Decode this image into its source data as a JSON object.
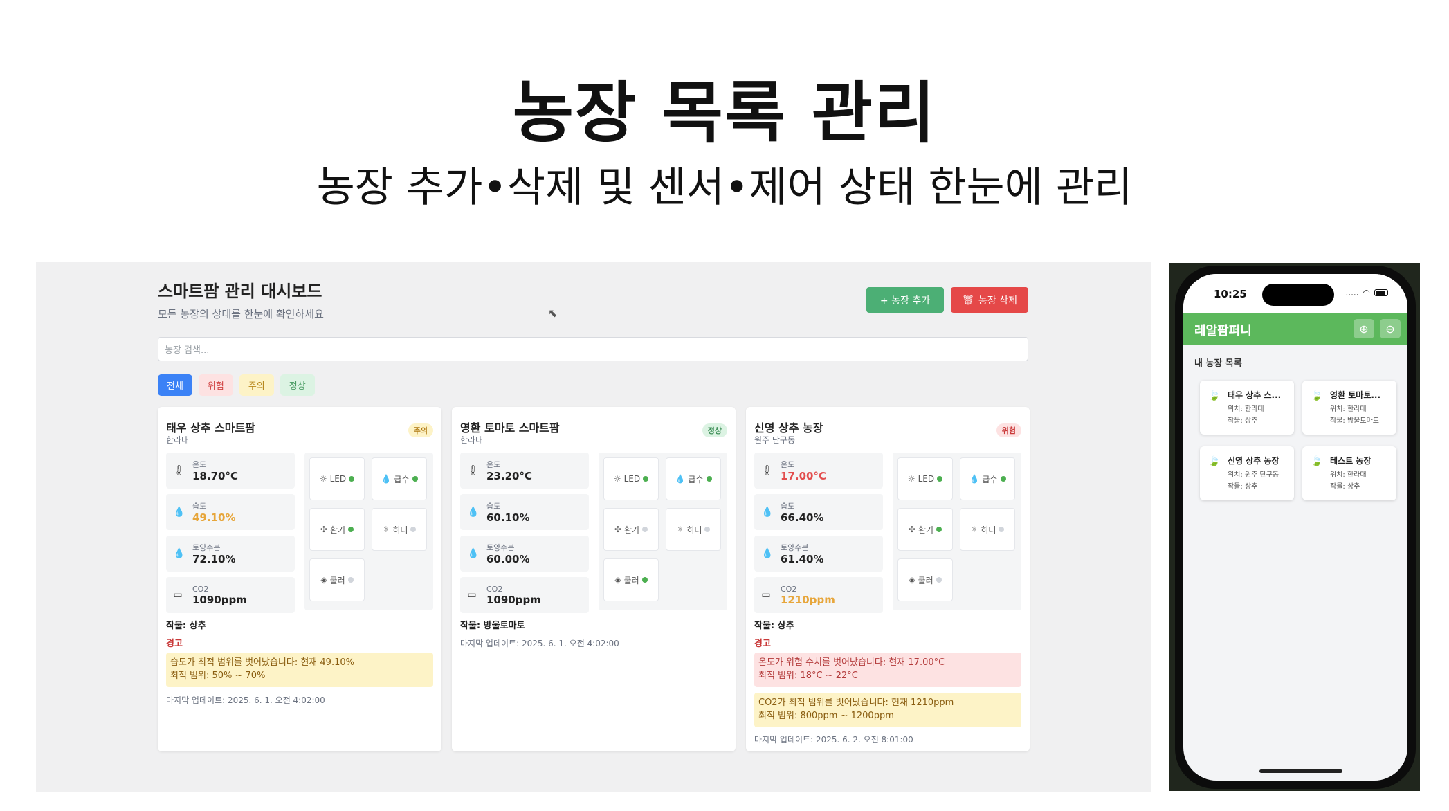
{
  "hero": {
    "title": "농장 목록 관리",
    "subtitle": "농장 추가•삭제 및 센서•제어 상태 한눈에 관리"
  },
  "dashboard": {
    "title": "스마트팜 관리 대시보드",
    "subtitle": "모든 농장의 상태를 한눈에 확인하세요",
    "add_button": "+ 농장 추가",
    "delete_button": "농장 삭제",
    "search_placeholder": "농장 검색...",
    "filters": [
      "전체",
      "위험",
      "주의",
      "정상"
    ],
    "sensor_labels": [
      "온도",
      "습도",
      "토양수분",
      "CO2"
    ],
    "control_labels": [
      "LED",
      "급수",
      "환기",
      "히터",
      "쿨러"
    ],
    "warning_header": "경고",
    "farms": [
      {
        "name": "태우 상추 스마트팜",
        "location": "한라대",
        "status": "주의",
        "temp": "18.70°C",
        "humidity": "49.10%",
        "soil": "72.10%",
        "co2": "1090ppm",
        "controls": {
          "led": true,
          "water": true,
          "vent": true,
          "heater": false,
          "cooler": false
        },
        "crop": "작물: 상추",
        "alerts": [
          {
            "line1": "습도가 최적 범위를 벗어났습니다: 현재 49.10%",
            "line2": "최적 범위: 50% ~ 70%"
          }
        ],
        "updated": "마지막 업데이트: 2025. 6. 1. 오전 4:02:00"
      },
      {
        "name": "영환 토마토 스마트팜",
        "location": "한라대",
        "status": "정상",
        "temp": "23.20°C",
        "humidity": "60.10%",
        "soil": "60.00%",
        "co2": "1090ppm",
        "controls": {
          "led": true,
          "water": true,
          "vent": false,
          "heater": false,
          "cooler": true
        },
        "crop": "작물: 방울토마토",
        "alerts": [],
        "updated": "마지막 업데이트: 2025. 6. 1. 오전 4:02:00"
      },
      {
        "name": "신영 상추 농장",
        "location": "원주 단구동",
        "status": "위험",
        "temp": "17.00°C",
        "humidity": "66.40%",
        "soil": "61.40%",
        "co2": "1210ppm",
        "controls": {
          "led": true,
          "water": true,
          "vent": true,
          "heater": false,
          "cooler": false
        },
        "crop": "작물: 상추",
        "alerts": [
          {
            "line1": "온도가 위험 수치를 벗어났습니다: 현재 17.00°C",
            "line2": "최적 범위: 18°C ~ 22°C"
          },
          {
            "line1": "CO2가 최적 범위를 벗어났습니다: 현재 1210ppm",
            "line2": "최적 범위: 800ppm ~ 1200ppm"
          }
        ],
        "updated": "마지막 업데이트: 2025. 6. 2. 오전 8:01:00"
      }
    ]
  },
  "mobile": {
    "time": "10:25",
    "status_dots": ".....",
    "app_title": "레알팜퍼니",
    "list_title": "내 농장 목록",
    "farms": [
      {
        "name": "태우 상추 스...",
        "location": "위치: 한라대",
        "crop": "작물: 상추"
      },
      {
        "name": "영환 토마토...",
        "location": "위치: 한라대",
        "crop": "작물: 방울토마토"
      },
      {
        "name": "신영 상추 농장",
        "location": "위치: 원주 단구동",
        "crop": "작물: 상추"
      },
      {
        "name": "테스트 농장",
        "location": "위치: 한라대",
        "crop": "작물: 상추"
      }
    ]
  },
  "colors": {
    "add_green": "#4caf75",
    "delete_red": "#e54848",
    "app_green": "#5cb85c",
    "filter_blue": "#3b82f6"
  }
}
